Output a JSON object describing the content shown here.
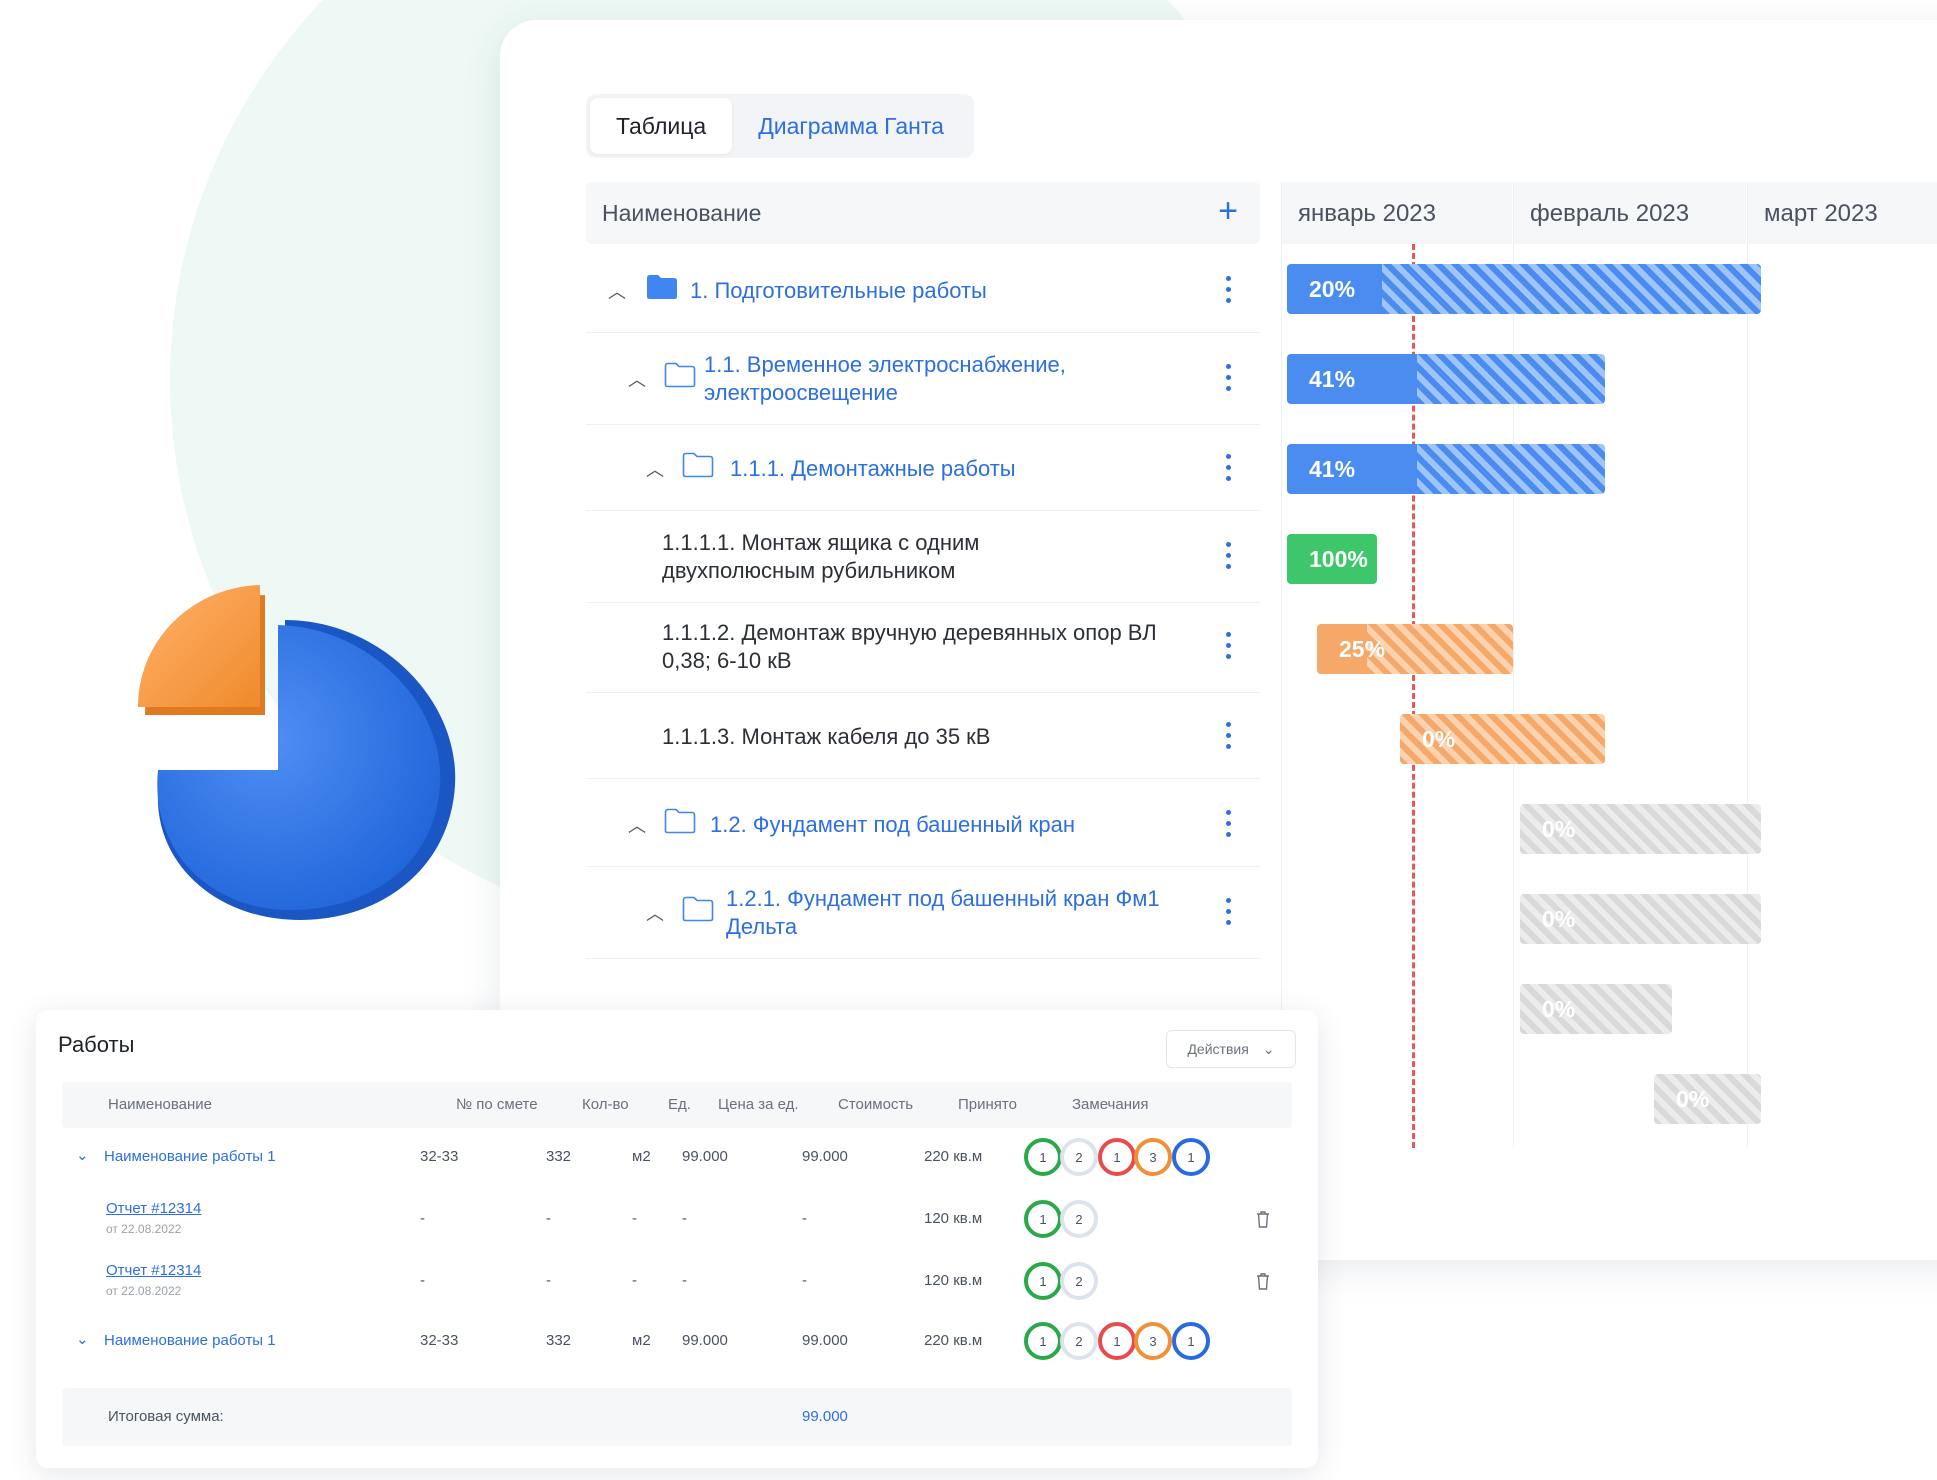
{
  "tabs": [
    {
      "label": "Таблица",
      "active": true
    },
    {
      "label": "Диаграмма Ганта",
      "active": false
    }
  ],
  "gantt": {
    "header": {
      "name_label": "Наименование",
      "add_icon": "plus-icon"
    },
    "months": [
      "январь 2023",
      "февраль 2023",
      "март 2023"
    ],
    "rows": [
      {
        "label": "1. Подготовительные работы",
        "percent": "20%"
      },
      {
        "label": "1.1. Временное электроснабжение, электроосвещение",
        "percent": "41%"
      },
      {
        "label": "1.1.1. Демонтажные работы",
        "percent": "41%"
      },
      {
        "label": "1.1.1.1. Монтаж ящика с одним двухполюсным рубильником",
        "percent": "100%"
      },
      {
        "label": "1.1.1.2. Демонтаж вручную деревянных опор ВЛ 0,38; 6-10 кВ",
        "percent": "25%"
      },
      {
        "label": "1.1.1.3. Монтаж кабеля до 35 кВ",
        "percent": "0%"
      },
      {
        "label": "1.2. Фундамент под башенный кран",
        "percent": "0%"
      },
      {
        "label": "1.2.1. Фундамент под башенный кран Фм1 Дельта",
        "percent": "0%"
      }
    ],
    "extra_bars": [
      "0%",
      "0%"
    ]
  },
  "works": {
    "title": "Работы",
    "actions_label": "Действия",
    "columns": [
      "Наименование",
      "№ по смете",
      "Кол-во",
      "Ед.",
      "Цена за ед.",
      "Стоимость",
      "Принято",
      "Замечания"
    ],
    "rows": [
      {
        "name": "Наименование работы 1",
        "estimate": "32-33",
        "qty": "332",
        "unit": "м2",
        "price": "99.000",
        "cost": "99.000",
        "accepted": "220 кв.м",
        "remarks": [
          "1",
          "2",
          "1",
          "3",
          "1"
        ]
      },
      {
        "name": "Отчет #12314",
        "date": "от 22.08.2022",
        "estimate": "-",
        "qty": "-",
        "unit": "-",
        "price": "-",
        "cost": "-",
        "accepted": "120 кв.м",
        "remarks": [
          "1",
          "2"
        ]
      },
      {
        "name": "Отчет #12314",
        "date": "от 22.08.2022",
        "estimate": "-",
        "qty": "-",
        "unit": "-",
        "price": "-",
        "cost": "-",
        "accepted": "120 кв.м",
        "remarks": [
          "1",
          "2"
        ]
      },
      {
        "name": "Наименование работы 1",
        "estimate": "32-33",
        "qty": "332",
        "unit": "м2",
        "price": "99.000",
        "cost": "99.000",
        "accepted": "220 кв.м",
        "remarks": [
          "1",
          "2",
          "1",
          "3",
          "1"
        ]
      }
    ],
    "total_label": "Итоговая сумма:",
    "total_value": "99.000"
  },
  "colors": {
    "accent": "#2d6fe0",
    "bar_blue": "#4a8cf0",
    "bar_green": "#3ec76a",
    "bar_orange": "#f6a869",
    "bar_gray": "#d9d9d9",
    "today_line": "#e85656"
  }
}
